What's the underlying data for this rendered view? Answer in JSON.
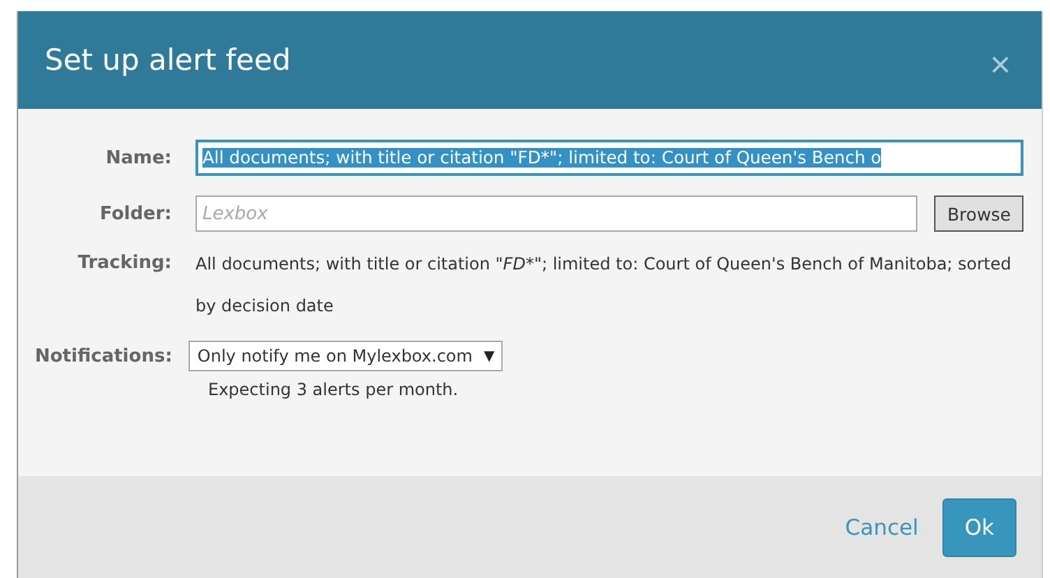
{
  "dialog": {
    "title": "Set up alert feed",
    "close": "×"
  },
  "name": {
    "label": "Name:",
    "value": "All documents; with title or citation \"FD*\"; limited to: Court of Queen's Bench o",
    "selected": true
  },
  "folder": {
    "label": "Folder:",
    "placeholder": "Lexbox",
    "button": "Browse"
  },
  "tracking": {
    "label": "Tracking:",
    "parts": [
      {
        "text": "All documents; with title or citation ",
        "italic": false
      },
      {
        "text": "\"FD*\"",
        "italic": true
      },
      {
        "text": "; limited to: Court of Queen's Bench of Manitoba; sorted by decision date",
        "italic": false
      }
    ]
  },
  "notifications": {
    "label": "Notifications:",
    "value": "Only notify me on Mylexbox.com",
    "caret": "▼",
    "note": "Expecting 3 alerts per month."
  },
  "buttons": [
    {
      "label": "Cancel",
      "kind": "link"
    },
    {
      "label": "Ok",
      "kind": "primary"
    }
  ]
}
